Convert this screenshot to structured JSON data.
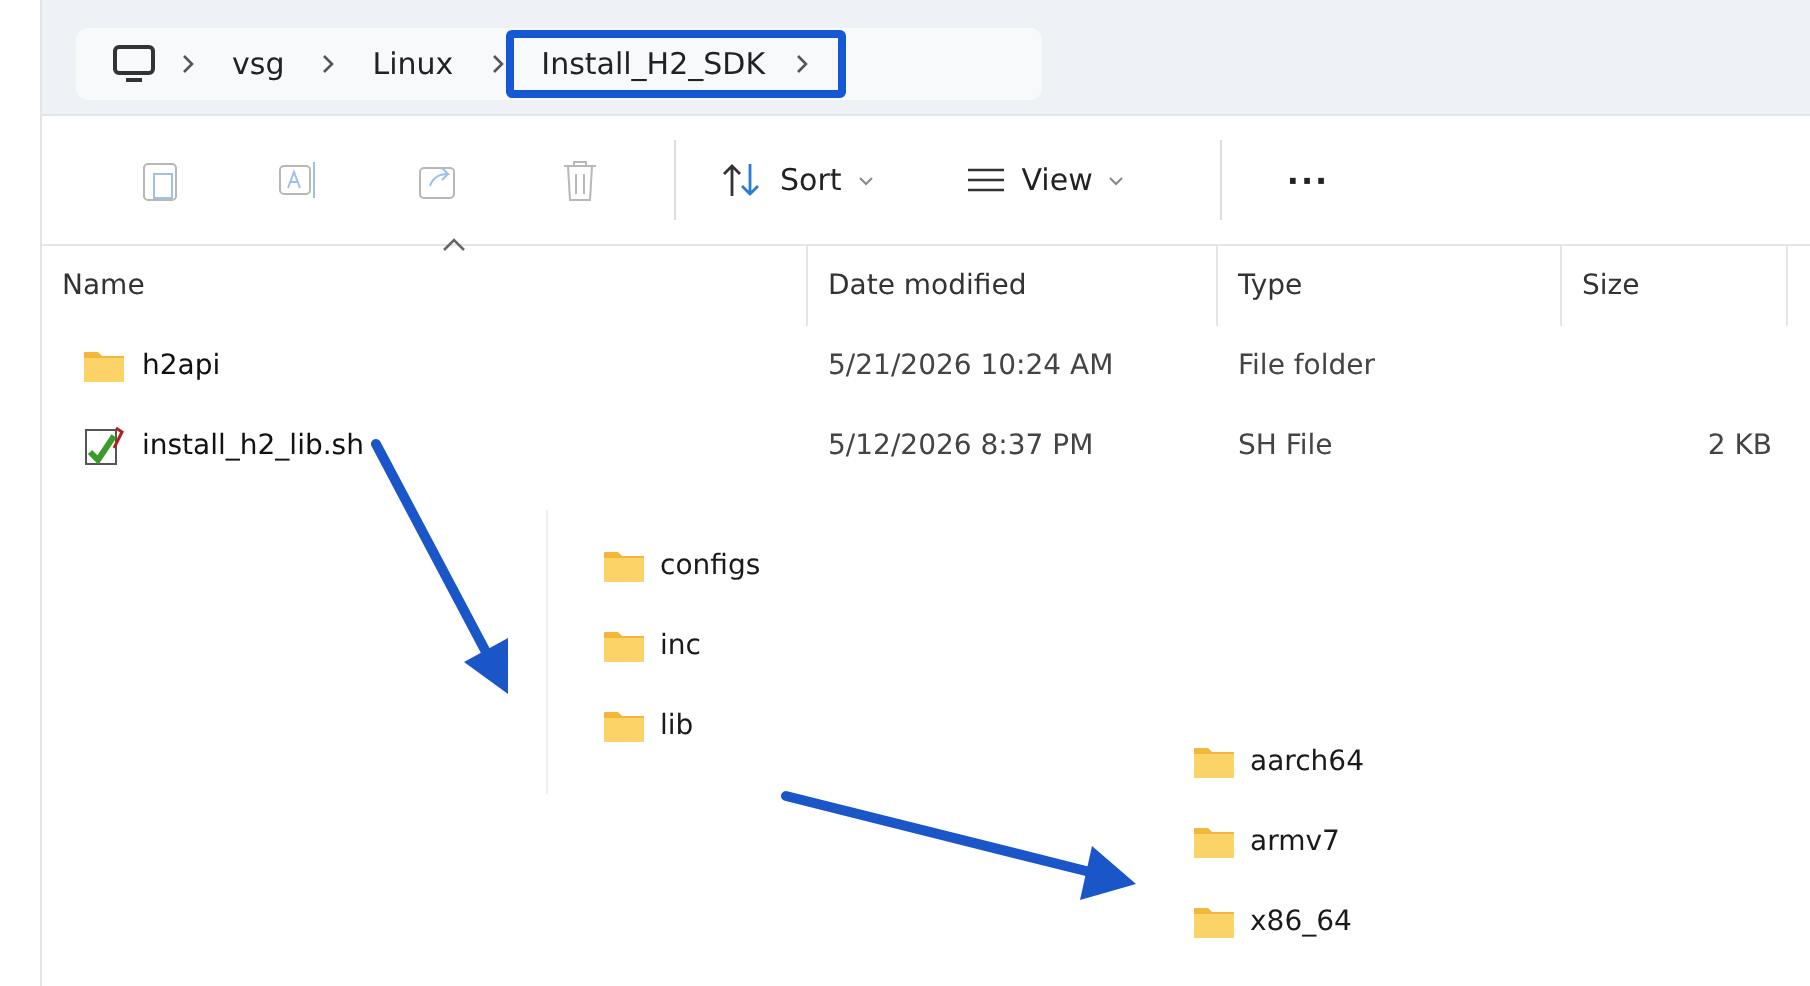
{
  "breadcrumb": [
    {
      "label": "vsg",
      "highlighted": false
    },
    {
      "label": "Linux",
      "highlighted": false
    },
    {
      "label": "Install_H2_SDK",
      "highlighted": true
    }
  ],
  "toolbar": {
    "sort": "Sort",
    "view": "View",
    "more": "···"
  },
  "columns": [
    "Name",
    "Date modified",
    "Type",
    "Size"
  ],
  "rows": [
    {
      "kind": "folder",
      "name": "h2api",
      "date": "5/21/2026 10:24 AM",
      "type": "File folder"
    },
    {
      "kind": "script",
      "name": "install_h2_lib.sh",
      "date": "5/12/2026 8:37 PM",
      "type": "SH File",
      "size": "2 KB"
    }
  ],
  "subfolders": [
    {
      "name": "configs"
    },
    {
      "name": "inc"
    },
    {
      "name": "lib",
      "children": [
        {
          "name": "aarch64"
        },
        {
          "name": "armv7"
        },
        {
          "name": "x86_64"
        }
      ]
    }
  ]
}
